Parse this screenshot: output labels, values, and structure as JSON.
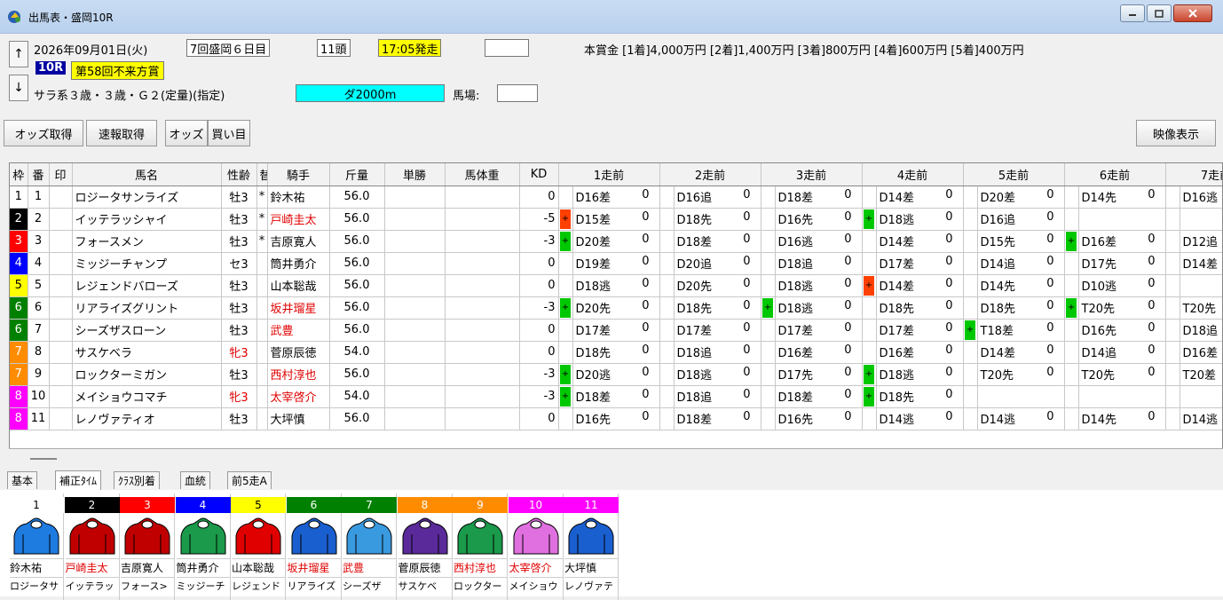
{
  "window": {
    "title": "出馬表・盛岡10R"
  },
  "header": {
    "up_arrow": "↑",
    "down_arrow": "↓",
    "date": "2026年09月01日(火)",
    "meeting": "7回盛岡６日目",
    "runners": "11頭",
    "post_time": "17:05発走",
    "race_no": "10R",
    "race_name": "第58回不来方賞",
    "conditions": "サラ系３歳・３歳・Ｇ２(定量)(指定)",
    "course": "ダ2000m",
    "baba_label": "馬場:",
    "prize": "本賞金 [1着]4,000万円 [2着]1,400万円 [3着]800万円 [4着]600万円 [5着]400万円"
  },
  "toolbar": {
    "odds_get": "オッズ取得",
    "sokuhou_get": "速報取得",
    "odds": "オッズ",
    "kaime": "買い目",
    "video": "映像表示"
  },
  "columns": [
    "枠",
    "番",
    "印",
    "馬名",
    "性齢",
    "替",
    "騎手",
    "斤量",
    "単勝",
    "馬体重",
    "KD",
    "1走前",
    "2走前",
    "3走前",
    "4走前",
    "5走前",
    "6走前",
    "7走前"
  ],
  "colors": {
    "waku": [
      "#ffffff",
      "#000000",
      "#ff0000",
      "#0000ff",
      "#ffff00",
      "#008000",
      "#ff8c00",
      "#ff00ff"
    ],
    "plus": "#00c800",
    "red_plus": "#ff4000",
    "title_bg": "#ffff00",
    "race_no_bg": "#0000a0",
    "course_bg": "#00ffff",
    "post_bg": "#ffff00"
  },
  "rows": [
    {
      "waku": "1",
      "wc": 0,
      "ban": "1",
      "name": "ロジータサンライズ",
      "sex": "牡3",
      "star": "*",
      "jockey": "鈴木祐",
      "jr": false,
      "sr": false,
      "kin": "56.0",
      "kd": "0",
      "r": [
        [
          "",
          "D16差",
          "0"
        ],
        [
          "",
          "D16追",
          "0"
        ],
        [
          "",
          "D18差",
          "0"
        ],
        [
          "",
          "D14差",
          "0"
        ],
        [
          "",
          "D20差",
          "0"
        ],
        [
          "",
          "D14先",
          "0"
        ],
        [
          "",
          "D16逃",
          "0"
        ]
      ]
    },
    {
      "waku": "2",
      "wc": 1,
      "ban": "2",
      "name": "イッテラッシャイ",
      "sex": "牡3",
      "star": "*",
      "jockey": "戸崎圭太",
      "jr": true,
      "sr": false,
      "kin": "56.0",
      "kd": "-5",
      "r": [
        [
          "r",
          "D15差",
          "0"
        ],
        [
          "",
          "D18先",
          "0"
        ],
        [
          "",
          "D16先",
          "0"
        ],
        [
          "g",
          "D18逃",
          "0"
        ],
        [
          "",
          "D16追",
          "0"
        ],
        [
          "",
          "",
          ""
        ],
        [
          "",
          "",
          ""
        ]
      ]
    },
    {
      "waku": "3",
      "wc": 2,
      "ban": "3",
      "name": "フォースメン",
      "sex": "牡3",
      "star": "*",
      "jockey": "吉原寛人",
      "jr": false,
      "sr": false,
      "kin": "56.0",
      "kd": "-3",
      "r": [
        [
          "g",
          "D20差",
          "0"
        ],
        [
          "",
          "D18差",
          "0"
        ],
        [
          "",
          "D16逃",
          "0"
        ],
        [
          "",
          "D14差",
          "0"
        ],
        [
          "",
          "D15先",
          "0"
        ],
        [
          "g",
          "D16差",
          "0"
        ],
        [
          "",
          "D12追",
          "0"
        ]
      ]
    },
    {
      "waku": "4",
      "wc": 3,
      "ban": "4",
      "name": "ミッジーチャンプ",
      "sex": "セ3",
      "star": "",
      "jockey": "筒井勇介",
      "jr": false,
      "sr": false,
      "kin": "56.0",
      "kd": "0",
      "r": [
        [
          "",
          "D19差",
          "0"
        ],
        [
          "",
          "D20追",
          "0"
        ],
        [
          "",
          "D18追",
          "0"
        ],
        [
          "",
          "D17差",
          "0"
        ],
        [
          "",
          "D14追",
          "0"
        ],
        [
          "",
          "D17先",
          "0"
        ],
        [
          "",
          "D14差",
          "0"
        ]
      ]
    },
    {
      "waku": "5",
      "wc": 4,
      "ban": "5",
      "name": "レジェンドバローズ",
      "sex": "牡3",
      "star": "",
      "jockey": "山本聡哉",
      "jr": false,
      "sr": false,
      "kin": "56.0",
      "kd": "0",
      "r": [
        [
          "",
          "D18逃",
          "0"
        ],
        [
          "",
          "D20先",
          "0"
        ],
        [
          "",
          "D18逃",
          "0"
        ],
        [
          "r",
          "D14差",
          "0"
        ],
        [
          "",
          "D14先",
          "0"
        ],
        [
          "",
          "D10逃",
          "0"
        ],
        [
          "",
          "",
          ""
        ]
      ]
    },
    {
      "waku": "6",
      "wc": 5,
      "ban": "6",
      "name": "リアライズグリント",
      "sex": "牡3",
      "star": "",
      "jockey": "坂井瑠星",
      "jr": true,
      "sr": false,
      "kin": "56.0",
      "kd": "-3",
      "r": [
        [
          "g",
          "D20先",
          "0"
        ],
        [
          "",
          "D18先",
          "0"
        ],
        [
          "g",
          "D18逃",
          "0"
        ],
        [
          "",
          "D18先",
          "0"
        ],
        [
          "",
          "D18先",
          "0"
        ],
        [
          "g",
          "T20先",
          "0"
        ],
        [
          "",
          "T20先",
          "0"
        ]
      ]
    },
    {
      "waku": "6",
      "wc": 5,
      "ban": "7",
      "name": "シーズザスローン",
      "sex": "牡3",
      "star": "",
      "jockey": "武豊",
      "jr": true,
      "sr": false,
      "kin": "56.0",
      "kd": "0",
      "r": [
        [
          "",
          "D17差",
          "0"
        ],
        [
          "",
          "D17差",
          "0"
        ],
        [
          "",
          "D17差",
          "0"
        ],
        [
          "",
          "D17差",
          "0"
        ],
        [
          "g",
          "T18差",
          "0"
        ],
        [
          "",
          "D16先",
          "0"
        ],
        [
          "",
          "D18追",
          "0"
        ]
      ]
    },
    {
      "waku": "7",
      "wc": 6,
      "ban": "8",
      "name": "サスケベラ",
      "sex": "牝3",
      "star": "",
      "jockey": "菅原辰徳",
      "jr": false,
      "sr": true,
      "kin": "54.0",
      "kd": "0",
      "r": [
        [
          "",
          "D18先",
          "0"
        ],
        [
          "",
          "D18追",
          "0"
        ],
        [
          "",
          "D16差",
          "0"
        ],
        [
          "",
          "D16差",
          "0"
        ],
        [
          "",
          "D14差",
          "0"
        ],
        [
          "",
          "D14追",
          "0"
        ],
        [
          "",
          "D16差",
          "0"
        ]
      ]
    },
    {
      "waku": "7",
      "wc": 6,
      "ban": "9",
      "name": "ロックターミガン",
      "sex": "牡3",
      "star": "",
      "jockey": "西村淳也",
      "jr": true,
      "sr": false,
      "kin": "56.0",
      "kd": "-3",
      "r": [
        [
          "g",
          "D20逃",
          "0"
        ],
        [
          "",
          "D18逃",
          "0"
        ],
        [
          "",
          "D17先",
          "0"
        ],
        [
          "g",
          "D18逃",
          "0"
        ],
        [
          "",
          "T20先",
          "0"
        ],
        [
          "",
          "T20先",
          "0"
        ],
        [
          "",
          "T20差",
          "0"
        ]
      ]
    },
    {
      "waku": "8",
      "wc": 7,
      "ban": "10",
      "name": "メイショウコマチ",
      "sex": "牝3",
      "star": "",
      "jockey": "太宰啓介",
      "jr": true,
      "sr": true,
      "kin": "54.0",
      "kd": "-3",
      "r": [
        [
          "g",
          "D18差",
          "0"
        ],
        [
          "",
          "D18追",
          "0"
        ],
        [
          "",
          "D18差",
          "0"
        ],
        [
          "g",
          "D18先",
          "0"
        ],
        [
          "",
          "",
          ""
        ],
        [
          "",
          "",
          ""
        ],
        [
          "",
          "",
          ""
        ]
      ]
    },
    {
      "waku": "8",
      "wc": 7,
      "ban": "11",
      "name": "レノヴァティオ",
      "sex": "牡3",
      "star": "",
      "jockey": "大坪慎",
      "jr": false,
      "sr": false,
      "kin": "56.0",
      "kd": "0",
      "r": [
        [
          "",
          "D16先",
          "0"
        ],
        [
          "",
          "D18差",
          "0"
        ],
        [
          "",
          "D16先",
          "0"
        ],
        [
          "",
          "D14逃",
          "0"
        ],
        [
          "",
          "D14逃",
          "0"
        ],
        [
          "",
          "D14先",
          "0"
        ],
        [
          "",
          "D14逃",
          "0"
        ]
      ]
    }
  ],
  "tabs": [
    "基本",
    "補正ﾀｲﾑ",
    "ｸﾗｽ別着",
    "血統",
    "前5走A"
  ],
  "silks": [
    {
      "n": "1",
      "jockey": "鈴木祐",
      "horse": "ロジータサ",
      "jr": false
    },
    {
      "n": "2",
      "jockey": "戸崎圭太",
      "horse": "イッテラッ",
      "jr": true
    },
    {
      "n": "3",
      "jockey": "吉原寛人",
      "horse": "フォース>",
      "jr": false
    },
    {
      "n": "4",
      "jockey": "筒井勇介",
      "horse": "ミッジーチ",
      "jr": false
    },
    {
      "n": "5",
      "jockey": "山本聡哉",
      "horse": "レジェンド",
      "jr": false
    },
    {
      "n": "6",
      "jockey": "坂井瑠星",
      "horse": "リアライズ",
      "jr": true
    },
    {
      "n": "7",
      "jockey": "武豊",
      "horse": "シーズザ",
      "jr": true
    },
    {
      "n": "8",
      "jockey": "菅原辰徳",
      "horse": "サスケベ",
      "jr": false
    },
    {
      "n": "9",
      "jockey": "西村淳也",
      "horse": "ロックター",
      "jr": true
    },
    {
      "n": "10",
      "jockey": "太宰啓介",
      "horse": "メイショウ",
      "jr": true
    },
    {
      "n": "11",
      "jockey": "大坪慎",
      "horse": "レノヴァテ",
      "jr": false
    }
  ]
}
